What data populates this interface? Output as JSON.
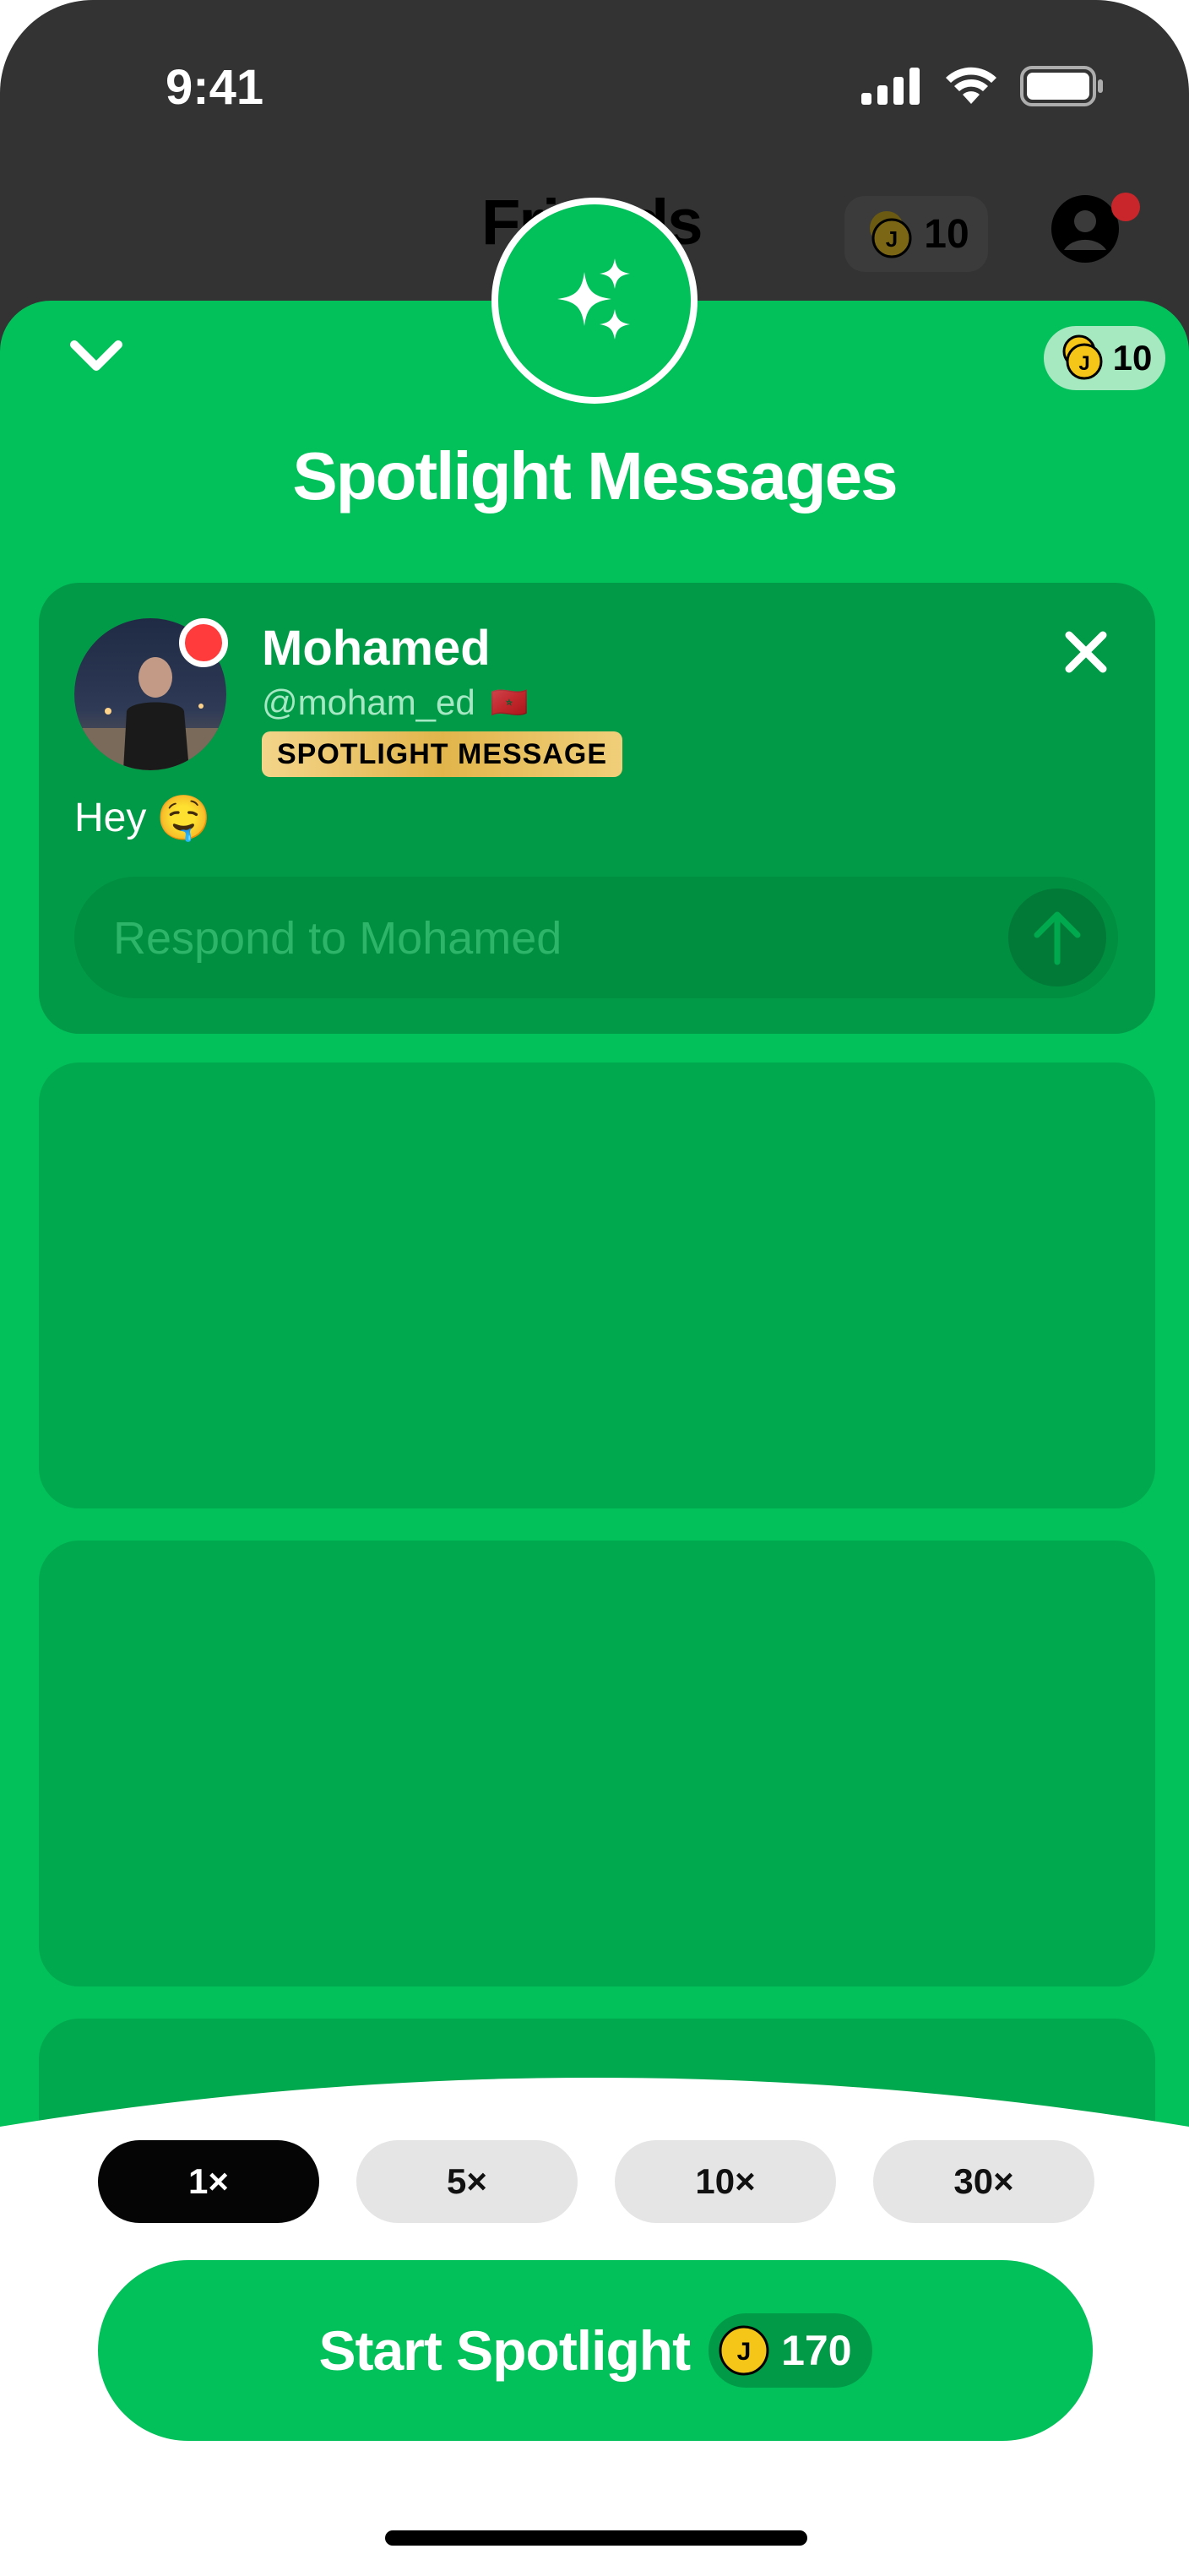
{
  "status_bar": {
    "time": "9:41"
  },
  "background_screen": {
    "title": "Friends",
    "coins": "10"
  },
  "sheet": {
    "title": "Spotlight Messages",
    "coin_balance": "10"
  },
  "message_card": {
    "sender_name": "Mohamed",
    "sender_handle": "@moham_ed",
    "flag": "🇲🇦",
    "tag": "SPOTLIGHT MESSAGE",
    "message": "Hey",
    "message_emoji": "🤤",
    "reply_placeholder": "Respond to Mohamed"
  },
  "multipliers": [
    {
      "label": "1×",
      "selected": true
    },
    {
      "label": "5×",
      "selected": false
    },
    {
      "label": "10×",
      "selected": false
    },
    {
      "label": "30×",
      "selected": false
    }
  ],
  "start_button": {
    "label": "Start Spotlight",
    "price": "170"
  },
  "colors": {
    "accent_green": "#02c15a",
    "card_green": "#00a84e",
    "dark": "#333333",
    "coin_gold": "#f5c518",
    "notification_red": "#ff3b3b"
  },
  "icons": [
    "sparkle-icon",
    "chevron-down-icon",
    "coin-icon",
    "close-icon",
    "send-arrow-icon",
    "avatar-icon",
    "signal-icon",
    "wifi-icon",
    "battery-icon"
  ]
}
